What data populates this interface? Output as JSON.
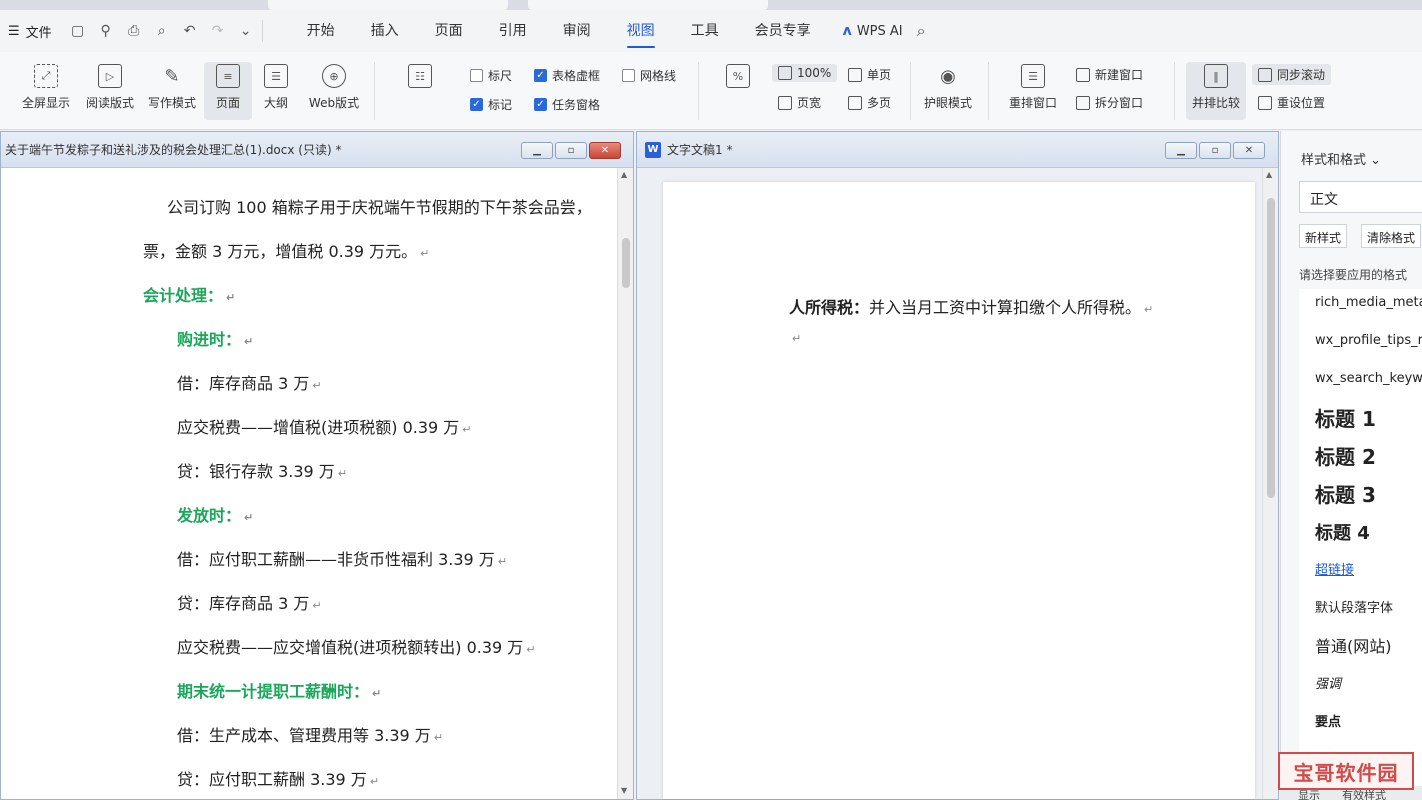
{
  "menubar": {
    "file_label": "文件",
    "tabs": [
      "开始",
      "插入",
      "页面",
      "引用",
      "审阅",
      "视图",
      "工具",
      "会员专享"
    ],
    "active_tab": "视图",
    "ai_label": "WPS AI"
  },
  "ribbon": {
    "big_buttons": [
      "全屏显示",
      "阅读版式",
      "写作模式",
      "页面",
      "大纲",
      "Web版式"
    ],
    "checkboxes": [
      {
        "label": "标尺",
        "checked": false
      },
      {
        "label": "表格虚框",
        "checked": true
      },
      {
        "label": "网格线",
        "checked": false
      },
      {
        "label": "标记",
        "checked": true
      },
      {
        "label": "任务窗格",
        "checked": true
      }
    ],
    "zoom_label": "100%",
    "page_width_label": "页宽",
    "single_page_label": "单页",
    "multi_page_label": "多页",
    "eye_mode_label": "护眼模式",
    "rearrange_label": "重排窗口",
    "new_window_label": "新建窗口",
    "split_window_label": "拆分窗口",
    "compare_label": "并排比较",
    "sync_scroll_label": "同步滚动",
    "reset_pos_label": "重设位置"
  },
  "window1": {
    "title": "关于端午节发粽子和送礼涉及的税会处理汇总(1).docx (只读) *",
    "lines": [
      {
        "text": "公司订购 100 箱粽子用于庆祝端午节假期的下午茶会品尝，",
        "style": "normal"
      },
      {
        "text": "票，金额 3 万元，增值税 0.39 万元。",
        "style": "normal"
      },
      {
        "text": "会计处理：",
        "style": "heading"
      },
      {
        "text": "购进时：",
        "style": "heading"
      },
      {
        "text": "借：库存商品  3 万",
        "style": "normal"
      },
      {
        "text": "应交税费——增值税(进项税额)  0.39 万",
        "style": "normal"
      },
      {
        "text": "贷：银行存款  3.39 万",
        "style": "normal"
      },
      {
        "text": "发放时：",
        "style": "heading"
      },
      {
        "text": "借：应付职工薪酬——非货币性福利  3.39 万",
        "style": "normal"
      },
      {
        "text": "贷：库存商品  3 万",
        "style": "normal"
      },
      {
        "text": "应交税费——应交增值税(进项税额转出)  0.39 万",
        "style": "normal"
      },
      {
        "text": "期末统一计提职工薪酬时：",
        "style": "heading"
      },
      {
        "text": "借：生产成本、管理费用等  3.39 万",
        "style": "normal"
      },
      {
        "text": "贷：应付职工薪酬  3.39 万",
        "style": "normal"
      }
    ]
  },
  "window2": {
    "title": "文字文稿1 *",
    "bold_prefix": "人所得税：",
    "body_text": "并入当月工资中计算扣缴个人所得税。"
  },
  "styles_pane": {
    "title": "样式和格式",
    "current_style": "正文",
    "new_style_label": "新样式",
    "clear_format_label": "清除格式",
    "apply_label": "请选择要应用的格式",
    "styles": [
      "rich_media_meta",
      "wx_profile_tips_r",
      "wx_search_keyw",
      "标题  1",
      "标题 2",
      "标题 3",
      "标题 4",
      "超链接",
      "默认段落字体",
      "普通(网站)",
      "强调",
      "要点",
      "正文"
    ],
    "bottom_show": "显示",
    "bottom_valid": "有效样式"
  },
  "watermark": "宝哥软件园"
}
